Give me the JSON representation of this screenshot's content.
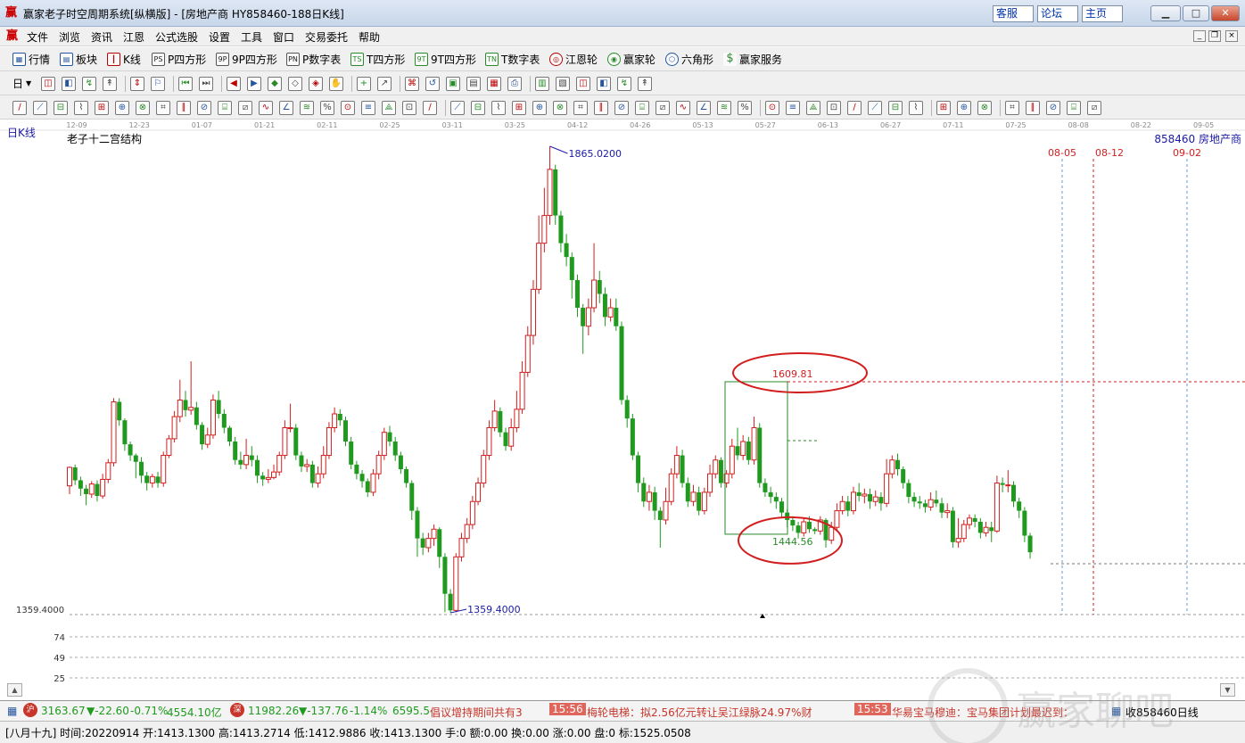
{
  "window": {
    "title": "赢家老子时空周期系统[纵横版] - [房地产商 HY858460-188日K线]",
    "links": [
      "客服",
      "论坛",
      "主页"
    ]
  },
  "menu": [
    "文件",
    "浏览",
    "资讯",
    "江恩",
    "公式选股",
    "设置",
    "工具",
    "窗口",
    "交易委托",
    "帮助"
  ],
  "toolbar1": [
    "行情",
    "板块",
    "K线",
    "P四方形",
    "9P四方形",
    "P数字表",
    "T四方形",
    "9T四方形",
    "T数字表",
    "江恩轮",
    "赢家轮",
    "六角形",
    "赢家服务"
  ],
  "toolbar1_icons": [
    "grid-icon",
    "blocks-icon",
    "kline-icon",
    "PS",
    "9P",
    "PN",
    "TS",
    "9T",
    "TN",
    "gann-wheel-icon",
    "win-wheel-icon",
    "hexagon-icon",
    "dollar-icon"
  ],
  "toolbar2_period": "日",
  "chart": {
    "period_label": "日K线",
    "title": "老子十二宫结构",
    "code": "858460 房地产商",
    "date_ticks": [
      "12-09",
      "12-23",
      "01-07",
      "01-21",
      "02-11",
      "02-25",
      "03-11",
      "03-25",
      "04-12",
      "04-26",
      "05-13",
      "05-27",
      "06-13",
      "06-27",
      "07-11",
      "07-25",
      "08-08",
      "08-22",
      "09-05"
    ],
    "high_label": "1865.0200",
    "low_label": "1359.4000",
    "y_axis_label": "1359.4000",
    "box_high": "1609.81",
    "box_low": "1444.56",
    "future_dates": [
      "08-05",
      "08-12",
      "09-02"
    ],
    "lower_ticks": [
      "74",
      "49",
      "25"
    ],
    "colors": {
      "up": "#d21e1e",
      "down": "#1f9a1f",
      "annot": "#d21e1e",
      "label": "#1a1aa8"
    }
  },
  "chart_data": {
    "type": "candlestick",
    "title": "老子十二宫结构",
    "series": [
      {
        "name": "858460 房地产商",
        "ohlc": [
          [
            1497,
            1517,
            1488,
            1518
          ],
          [
            1517,
            1503,
            1498,
            1520
          ],
          [
            1503,
            1494,
            1486,
            1507
          ],
          [
            1494,
            1488,
            1476,
            1498
          ],
          [
            1488,
            1499,
            1484,
            1502
          ],
          [
            1499,
            1486,
            1480,
            1503
          ],
          [
            1486,
            1504,
            1483,
            1510
          ],
          [
            1504,
            1522,
            1500,
            1526
          ],
          [
            1522,
            1588,
            1518,
            1592
          ],
          [
            1588,
            1568,
            1562,
            1592
          ],
          [
            1568,
            1542,
            1535,
            1570
          ],
          [
            1542,
            1530,
            1524,
            1545
          ],
          [
            1530,
            1523,
            1505,
            1532
          ],
          [
            1523,
            1508,
            1500,
            1528
          ],
          [
            1508,
            1500,
            1492,
            1512
          ],
          [
            1500,
            1507,
            1495,
            1510
          ],
          [
            1507,
            1500,
            1495,
            1512
          ],
          [
            1500,
            1530,
            1496,
            1534
          ],
          [
            1530,
            1548,
            1527,
            1552
          ],
          [
            1548,
            1572,
            1544,
            1578
          ],
          [
            1572,
            1590,
            1566,
            1612
          ],
          [
            1590,
            1579,
            1572,
            1600
          ],
          [
            1579,
            1582,
            1574,
            1632
          ],
          [
            1582,
            1563,
            1558,
            1588
          ],
          [
            1563,
            1542,
            1536,
            1566
          ],
          [
            1542,
            1552,
            1538,
            1560
          ],
          [
            1552,
            1590,
            1548,
            1596
          ],
          [
            1590,
            1575,
            1570,
            1600
          ],
          [
            1575,
            1560,
            1554,
            1580
          ],
          [
            1560,
            1545,
            1540,
            1562
          ],
          [
            1545,
            1525,
            1520,
            1550
          ],
          [
            1525,
            1520,
            1515,
            1534
          ],
          [
            1520,
            1530,
            1515,
            1548
          ],
          [
            1530,
            1525,
            1518,
            1540
          ],
          [
            1525,
            1508,
            1500,
            1530
          ],
          [
            1508,
            1504,
            1497,
            1512
          ],
          [
            1504,
            1506,
            1500,
            1515
          ],
          [
            1506,
            1512,
            1504,
            1520
          ],
          [
            1512,
            1530,
            1508,
            1534
          ],
          [
            1530,
            1560,
            1526,
            1568
          ],
          [
            1560,
            1560,
            1555,
            1586
          ],
          [
            1560,
            1530,
            1525,
            1564
          ],
          [
            1530,
            1518,
            1512,
            1534
          ],
          [
            1518,
            1520,
            1512,
            1526
          ],
          [
            1520,
            1500,
            1495,
            1524
          ],
          [
            1500,
            1510,
            1495,
            1518
          ],
          [
            1510,
            1530,
            1505,
            1540
          ],
          [
            1530,
            1560,
            1526,
            1566
          ],
          [
            1560,
            1575,
            1555,
            1582
          ],
          [
            1575,
            1568,
            1562,
            1580
          ],
          [
            1568,
            1545,
            1540,
            1572
          ],
          [
            1545,
            1520,
            1515,
            1550
          ],
          [
            1520,
            1510,
            1504,
            1524
          ],
          [
            1510,
            1502,
            1495,
            1514
          ],
          [
            1502,
            1490,
            1485,
            1505
          ],
          [
            1490,
            1510,
            1486,
            1515
          ],
          [
            1510,
            1530,
            1504,
            1535
          ],
          [
            1530,
            1555,
            1525,
            1560
          ],
          [
            1555,
            1545,
            1540,
            1562
          ],
          [
            1545,
            1530,
            1524,
            1550
          ],
          [
            1530,
            1515,
            1510,
            1534
          ],
          [
            1515,
            1500,
            1495,
            1518
          ],
          [
            1500,
            1470,
            1460,
            1503
          ],
          [
            1470,
            1440,
            1420,
            1474
          ],
          [
            1440,
            1430,
            1422,
            1446
          ],
          [
            1430,
            1440,
            1425,
            1446
          ],
          [
            1440,
            1450,
            1432,
            1455
          ],
          [
            1450,
            1420,
            1408,
            1452
          ],
          [
            1420,
            1380,
            1360,
            1424
          ],
          [
            1380,
            1362,
            1359.4,
            1385
          ],
          [
            1362,
            1420,
            1360,
            1424
          ],
          [
            1420,
            1440,
            1415,
            1446
          ],
          [
            1440,
            1455,
            1435,
            1462
          ],
          [
            1455,
            1480,
            1450,
            1486
          ],
          [
            1480,
            1500,
            1476,
            1506
          ],
          [
            1500,
            1530,
            1495,
            1536
          ],
          [
            1530,
            1560,
            1525,
            1568
          ],
          [
            1560,
            1578,
            1556,
            1590
          ],
          [
            1578,
            1555,
            1550,
            1582
          ],
          [
            1555,
            1540,
            1535,
            1560
          ],
          [
            1540,
            1560,
            1535,
            1570
          ],
          [
            1560,
            1580,
            1555,
            1600
          ],
          [
            1580,
            1620,
            1575,
            1632
          ],
          [
            1620,
            1660,
            1615,
            1670
          ],
          [
            1660,
            1710,
            1650,
            1720
          ],
          [
            1710,
            1760,
            1705,
            1790
          ],
          [
            1760,
            1790,
            1750,
            1820
          ],
          [
            1790,
            1840,
            1780,
            1865.02
          ],
          [
            1840,
            1790,
            1780,
            1845
          ],
          [
            1790,
            1760,
            1750,
            1795
          ],
          [
            1760,
            1745,
            1735,
            1770
          ],
          [
            1745,
            1720,
            1700,
            1750
          ],
          [
            1720,
            1690,
            1680,
            1726
          ],
          [
            1690,
            1670,
            1640,
            1694
          ],
          [
            1670,
            1690,
            1660,
            1700
          ],
          [
            1690,
            1720,
            1685,
            1760
          ],
          [
            1720,
            1705,
            1695,
            1730
          ],
          [
            1705,
            1680,
            1670,
            1712
          ],
          [
            1680,
            1690,
            1675,
            1700
          ],
          [
            1690,
            1670,
            1665,
            1700
          ],
          [
            1670,
            1590,
            1585,
            1675
          ],
          [
            1590,
            1570,
            1560,
            1595
          ],
          [
            1570,
            1530,
            1525,
            1575
          ],
          [
            1530,
            1500,
            1490,
            1534
          ],
          [
            1500,
            1480,
            1474,
            1506
          ],
          [
            1480,
            1490,
            1470,
            1498
          ],
          [
            1490,
            1470,
            1460,
            1496
          ],
          [
            1470,
            1460,
            1430,
            1474
          ],
          [
            1460,
            1480,
            1455,
            1495
          ],
          [
            1480,
            1510,
            1476,
            1516
          ],
          [
            1510,
            1530,
            1505,
            1540
          ],
          [
            1530,
            1500,
            1495,
            1536
          ],
          [
            1500,
            1480,
            1474,
            1506
          ],
          [
            1480,
            1490,
            1475,
            1498
          ],
          [
            1490,
            1470,
            1465,
            1496
          ],
          [
            1470,
            1490,
            1466,
            1495
          ],
          [
            1490,
            1510,
            1485,
            1520
          ],
          [
            1510,
            1525,
            1505,
            1530
          ],
          [
            1525,
            1500,
            1495,
            1528
          ],
          [
            1500,
            1510,
            1495,
            1514
          ],
          [
            1510,
            1540,
            1505,
            1548
          ],
          [
            1540,
            1530,
            1525,
            1560
          ],
          [
            1530,
            1545,
            1525,
            1552
          ],
          [
            1545,
            1525,
            1520,
            1550
          ],
          [
            1525,
            1560,
            1520,
            1572
          ],
          [
            1560,
            1500,
            1495,
            1565
          ],
          [
            1500,
            1490,
            1485,
            1505
          ],
          [
            1490,
            1485,
            1478,
            1496
          ],
          [
            1485,
            1480,
            1472,
            1490
          ],
          [
            1480,
            1468,
            1462,
            1484
          ],
          [
            1468,
            1460,
            1452,
            1472
          ],
          [
            1460,
            1454,
            1448,
            1464
          ],
          [
            1454,
            1446,
            1440,
            1458
          ],
          [
            1446,
            1458,
            1442,
            1462
          ],
          [
            1458,
            1450,
            1446,
            1464
          ],
          [
            1450,
            1448,
            1444.56,
            1452
          ],
          [
            1448,
            1460,
            1444,
            1464
          ],
          [
            1460,
            1438,
            1430,
            1462
          ],
          [
            1438,
            1452,
            1434,
            1458
          ],
          [
            1452,
            1470,
            1448,
            1478
          ],
          [
            1470,
            1480,
            1466,
            1486
          ],
          [
            1480,
            1470,
            1464,
            1486
          ],
          [
            1470,
            1490,
            1466,
            1496
          ],
          [
            1490,
            1486,
            1480,
            1500
          ],
          [
            1486,
            1488,
            1478,
            1494
          ],
          [
            1488,
            1480,
            1472,
            1494
          ],
          [
            1480,
            1485,
            1475,
            1492
          ],
          [
            1485,
            1478,
            1470,
            1490
          ],
          [
            1478,
            1510,
            1474,
            1526
          ],
          [
            1510,
            1525,
            1505,
            1530
          ],
          [
            1525,
            1515,
            1508,
            1532
          ],
          [
            1515,
            1500,
            1494,
            1518
          ],
          [
            1500,
            1485,
            1478,
            1504
          ],
          [
            1485,
            1480,
            1474,
            1490
          ],
          [
            1480,
            1478,
            1472,
            1486
          ],
          [
            1478,
            1474,
            1468,
            1482
          ],
          [
            1474,
            1482,
            1470,
            1490
          ],
          [
            1482,
            1478,
            1474,
            1492
          ],
          [
            1478,
            1468,
            1462,
            1484
          ],
          [
            1468,
            1470,
            1462,
            1478
          ],
          [
            1470,
            1436,
            1430,
            1474
          ],
          [
            1436,
            1440,
            1430,
            1462
          ],
          [
            1440,
            1455,
            1436,
            1460
          ],
          [
            1455,
            1462,
            1450,
            1466
          ],
          [
            1462,
            1458,
            1452,
            1466
          ],
          [
            1458,
            1446,
            1440,
            1462
          ],
          [
            1446,
            1452,
            1442,
            1458
          ],
          [
            1452,
            1448,
            1436,
            1458
          ],
          [
            1448,
            1500,
            1446,
            1508
          ],
          [
            1500,
            1498,
            1490,
            1506
          ],
          [
            1498,
            1498,
            1490,
            1514
          ],
          [
            1498,
            1480,
            1474,
            1502
          ],
          [
            1480,
            1470,
            1462,
            1484
          ],
          [
            1470,
            1443,
            1436,
            1474
          ],
          [
            1443,
            1425,
            1418,
            1446
          ]
        ]
      }
    ],
    "x_range": [
      "12-09",
      "09-05"
    ],
    "ylim": [
      1359.4,
      1865.02
    ],
    "annotations": [
      "1865.0200",
      "1359.4000",
      "1609.81",
      "1444.56"
    ],
    "grid": false
  },
  "ticker": [
    {
      "idx": "3163.67",
      "chg": "▼-22.60",
      "pct": "-0.71%",
      "vol": "4554.10亿"
    },
    {
      "idx": "11982.26",
      "chg": "▼-137.76",
      "pct": "-1.14%",
      "vol": "6595.5"
    }
  ],
  "news": [
    {
      "time": "",
      "text": "倡议增持期间共有3"
    },
    {
      "time": "15:56",
      "text": "梅轮电梯：拟2.56亿元转让吴江绿脉24.97%财"
    },
    {
      "time": "15:53",
      "text": "华昜宝马穆迪：宝马集团计划最迟到："
    }
  ],
  "status_right": "收858460日线",
  "status_line": "[八月十九] 时间:20220914 开:1413.1300 高:1413.2714 低:1412.9886 收:1413.1300 手:0 额:0.00 换:0.00 涨:0.00 盘:0 标:1525.0508",
  "watermark": "赢家聊吧"
}
